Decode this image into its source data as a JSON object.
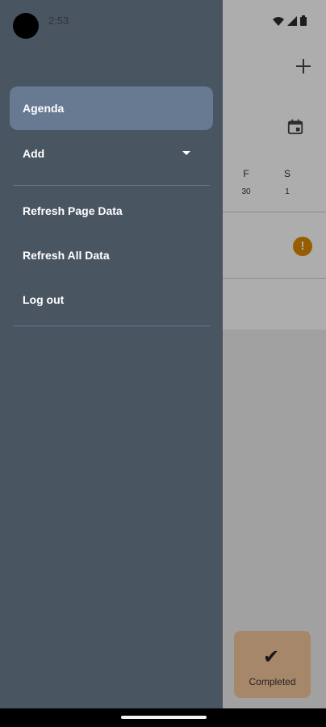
{
  "status_bar": {
    "time": "2:53"
  },
  "drawer": {
    "items": [
      {
        "label": "Agenda",
        "active": true
      },
      {
        "label": "Add"
      },
      {
        "label": "Refresh Page Data"
      },
      {
        "label": "Refresh All Data"
      },
      {
        "label": "Log out"
      }
    ]
  },
  "background": {
    "week_days": [
      {
        "letter": "F",
        "date": "30"
      },
      {
        "letter": "S",
        "date": "1"
      }
    ],
    "alert_glyph": "!",
    "completed_button": {
      "check": "✔",
      "label": "Completed"
    }
  },
  "colors": {
    "drawer_bg": "#4a5562",
    "active_item_bg": "#677a92",
    "alert": "#e08a00",
    "completed_bg": "#f7c79c"
  }
}
